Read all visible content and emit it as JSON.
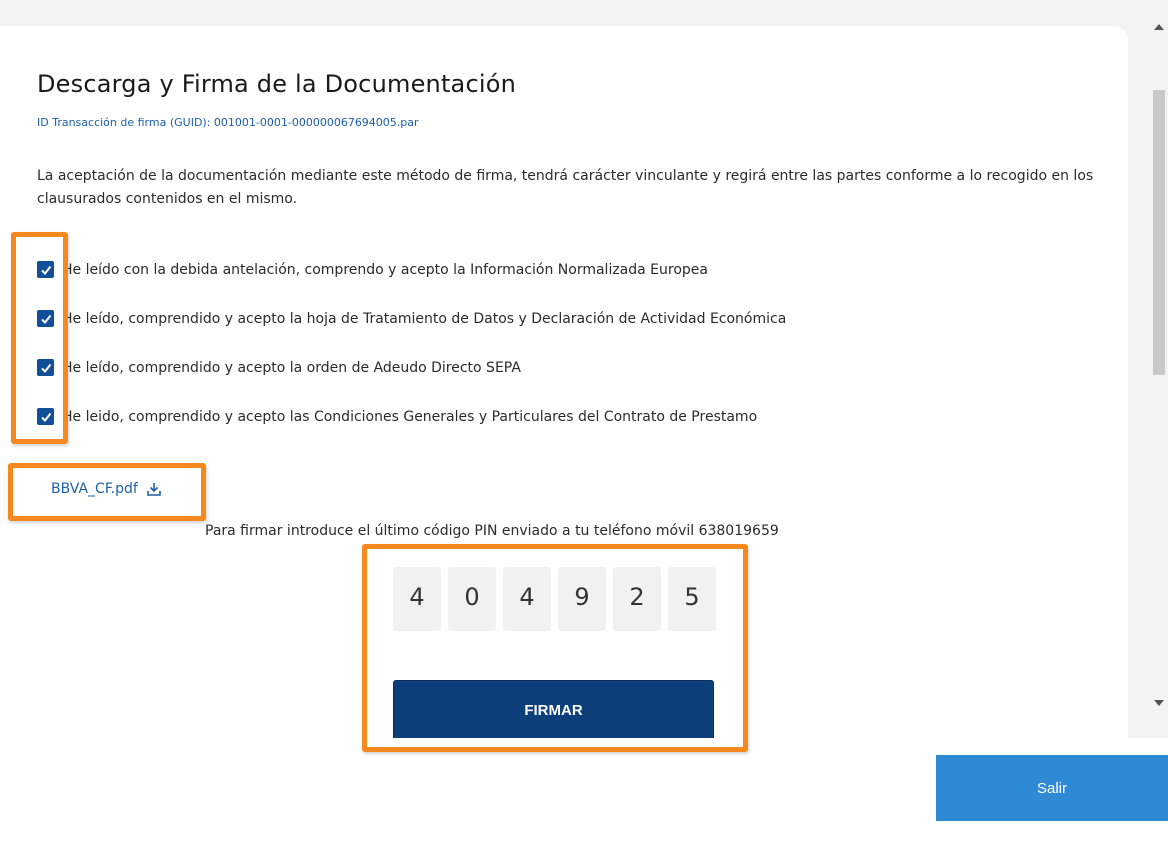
{
  "title": "Descarga y Firma de la Documentación",
  "guid": "ID Transacción de firma (GUID): 001001-0001-000000067694005.par",
  "intro": "La aceptación de la documentación mediante este método de firma, tendrá carácter vinculante y regirá entre las partes conforme a lo recogido en los clausurados contenidos en el mismo.",
  "checkboxes": [
    {
      "label": "He leído con la debida antelación, comprendo y acepto la Información Normalizada Europea",
      "checked": true
    },
    {
      "label": "He leído, comprendido y acepto la hoja de Tratamiento de Datos y Declaración de Actividad Económica",
      "checked": true
    },
    {
      "label": "He leído, comprendido y acepto la orden de Adeudo Directo SEPA",
      "checked": true
    },
    {
      "label": "He leido, comprendido y acepto las Condiciones Generales y Particulares del Contrato de Prestamo",
      "checked": true
    }
  ],
  "download": {
    "filename": "BBVA_CF.pdf",
    "icon": "download-icon"
  },
  "pin": {
    "instruction": "Para firmar introduce el último código PIN enviado a tu teléfono móvil 638019659",
    "digits": [
      "4",
      "0",
      "4",
      "9",
      "2",
      "5"
    ]
  },
  "buttons": {
    "sign": "FIRMAR",
    "exit": "Salir"
  },
  "colors": {
    "checkbox": "#114f98",
    "link": "#1d5fa9",
    "sign_button": "#0d3f7a",
    "exit_button": "#2f8ad6",
    "highlight": "#f5891d"
  }
}
